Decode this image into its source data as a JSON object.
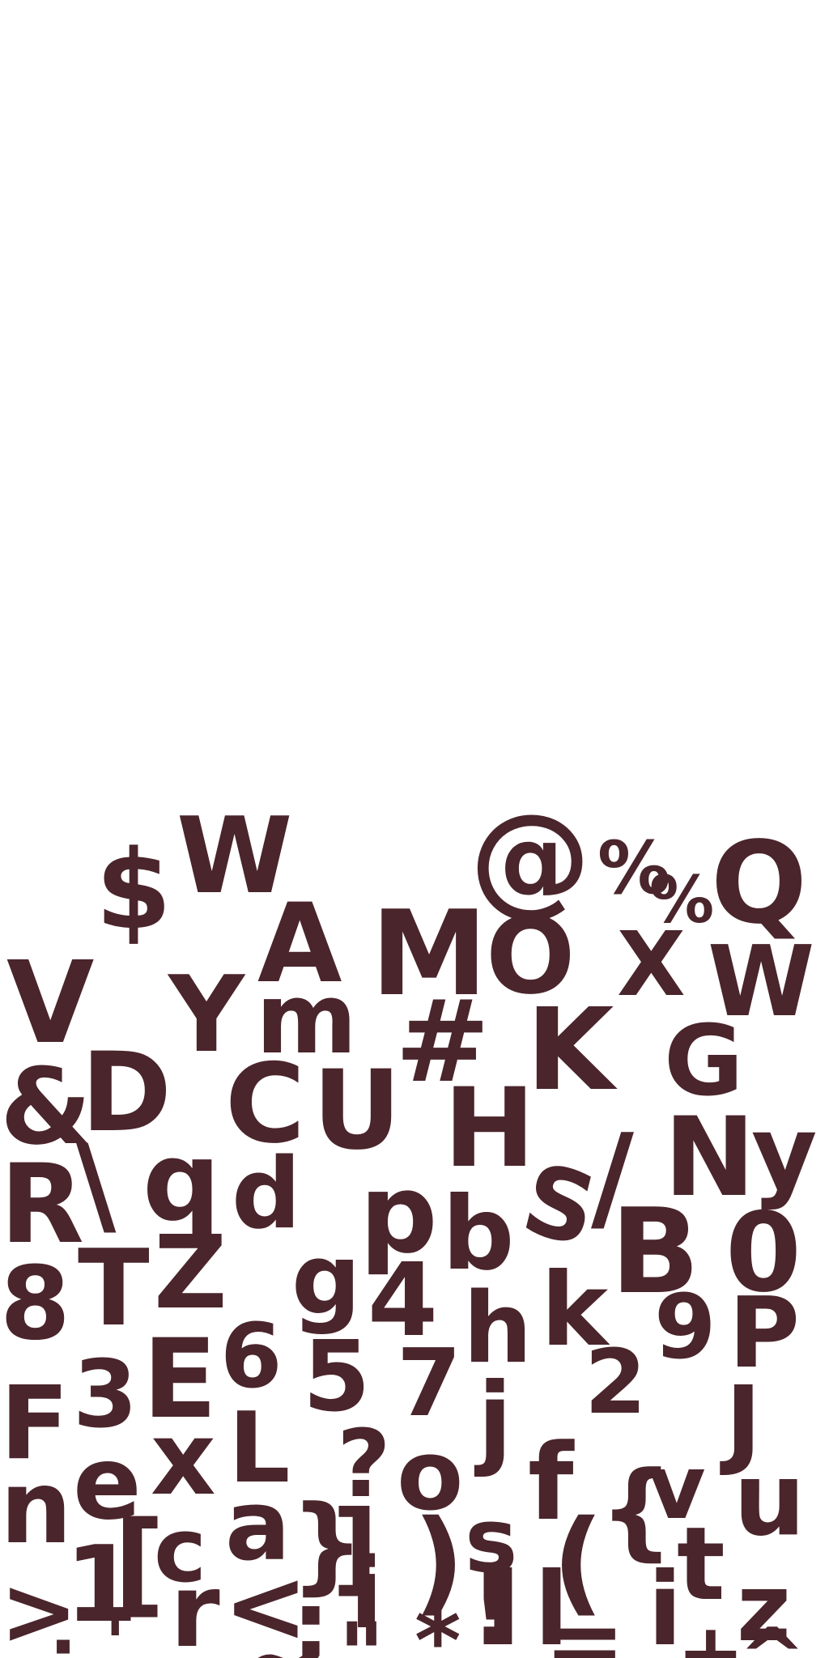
{
  "colors": {
    "background": "#ffffff",
    "glyph": "#4a252b"
  },
  "glyphs": [
    "$",
    "W",
    "@",
    "%",
    "%",
    "Q",
    "A",
    "M",
    "O",
    "X",
    "V",
    "Y",
    "m",
    "W",
    "#",
    "K",
    "G",
    "&",
    "D",
    "C",
    "U",
    "H",
    "R",
    "\\",
    "q",
    "d",
    "p",
    "b",
    "S",
    "/",
    "N",
    "y",
    "B",
    "0",
    "8",
    "T",
    "Z",
    "g",
    "4",
    "h",
    "k",
    "9",
    "P",
    "F",
    "3",
    "E",
    "6",
    "5",
    "7",
    "2",
    "J",
    "e",
    "x",
    "L",
    "?",
    "o",
    "j",
    "f",
    "v",
    "u",
    "n",
    "a",
    "c",
    "}",
    "]",
    "i",
    "s",
    ")",
    "(",
    "{",
    "t",
    "1",
    "[",
    "r",
    "<",
    ";",
    ",",
    "!",
    "=",
    "l",
    "l",
    "i",
    "z",
    ">",
    "'",
    "~",
    "\"",
    "*",
    ":",
    "-",
    "+",
    "^",
    "_",
    "."
  ]
}
